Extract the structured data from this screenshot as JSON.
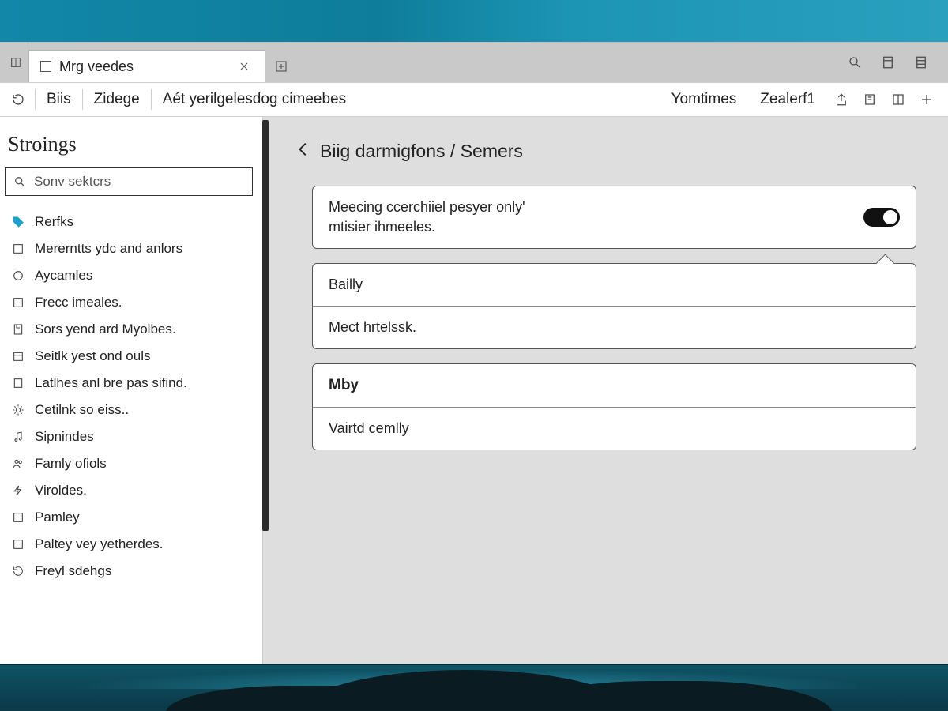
{
  "tab": {
    "title": "Mrg veedes"
  },
  "breadcrumbs": {
    "a": "Biis",
    "b": "Zidege",
    "c": "Aét yerilgelesdog cimeebes"
  },
  "toolbar_right": {
    "link1": "Yomtimes",
    "link2": "Zealerf1"
  },
  "sidebar": {
    "title": "Stroings",
    "search_placeholder": "Sonv sektcrs",
    "items": [
      {
        "label": "Rerfks"
      },
      {
        "label": "Mererntts ydc and anlors"
      },
      {
        "label": "Aycamles"
      },
      {
        "label": "Frecc imeales."
      },
      {
        "label": "Sors yend ard Myolbes."
      },
      {
        "label": "Seitlk yest ond ouls"
      },
      {
        "label": "Latlhes anl bre pas sifind."
      },
      {
        "label": "Cetilnk so eiss.."
      },
      {
        "label": "Sipnindes"
      },
      {
        "label": "Famly ofiols"
      },
      {
        "label": "Viroldes."
      },
      {
        "label": "Pamley"
      },
      {
        "label": "Paltey vey yetherdes."
      },
      {
        "label": "Freyl sdehgs"
      }
    ]
  },
  "content": {
    "heading": "Biig darmigfons / Semers",
    "card1": {
      "line1": "Meecing ccerchiiel pesyer only'",
      "line2": "mtisier ihmeeles."
    },
    "card2": {
      "row1": "Bailly",
      "row2": "Mect hrtelssk."
    },
    "card3": {
      "header": "Mby",
      "row2": "Vairtd cemlly"
    }
  }
}
